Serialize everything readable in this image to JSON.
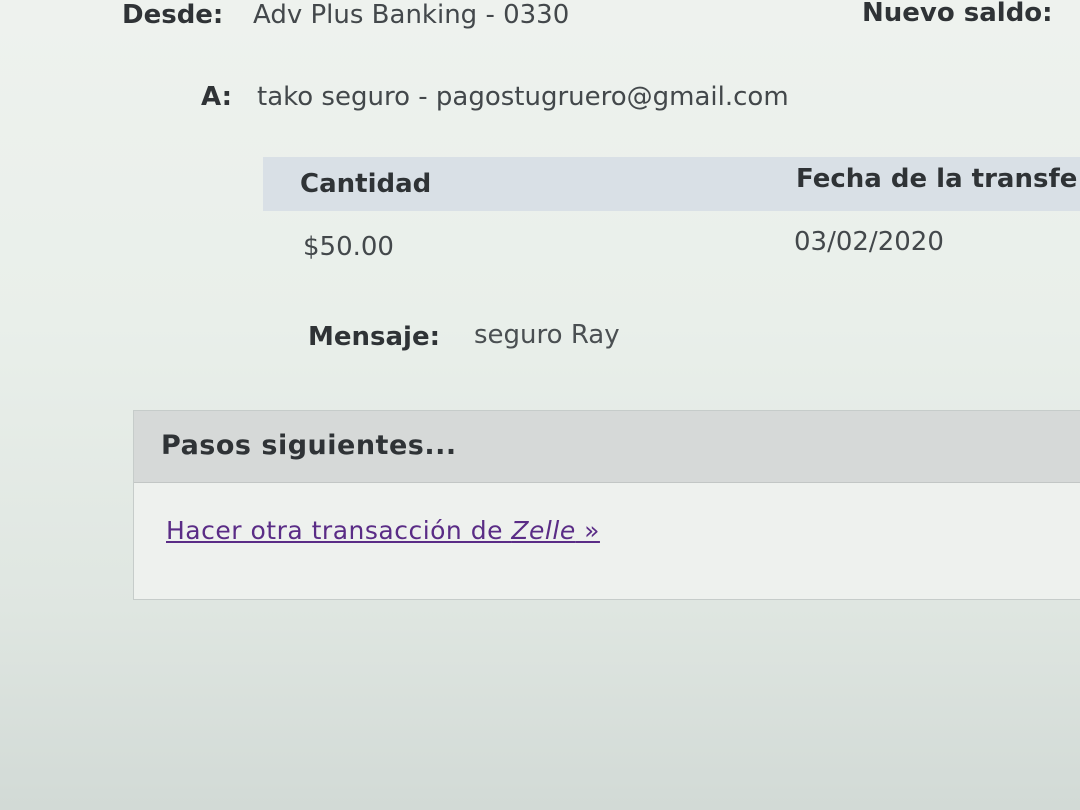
{
  "transfer": {
    "from_label": "Desde:",
    "from_value": "Adv Plus Banking - 0330",
    "new_balance_label": "Nuevo saldo:",
    "to_label": "A:",
    "to_value": "tako seguro - pagostugruero@gmail.com"
  },
  "details": {
    "columns": [
      "Cantidad",
      "Fecha de la transfe"
    ],
    "amount": "$50.00",
    "date": "03/02/2020",
    "message_label": "Mensaje:",
    "message_value": "seguro Ray"
  },
  "next_steps": {
    "title": "Pasos siguientes...",
    "link_text": "Hacer otra transacción de ",
    "link_brand": "Zelle",
    "link_suffix": " »"
  },
  "colors": {
    "link": "#5a2c86",
    "table_header": "#d9e0e6",
    "panel_header": "#d6d9d8"
  }
}
